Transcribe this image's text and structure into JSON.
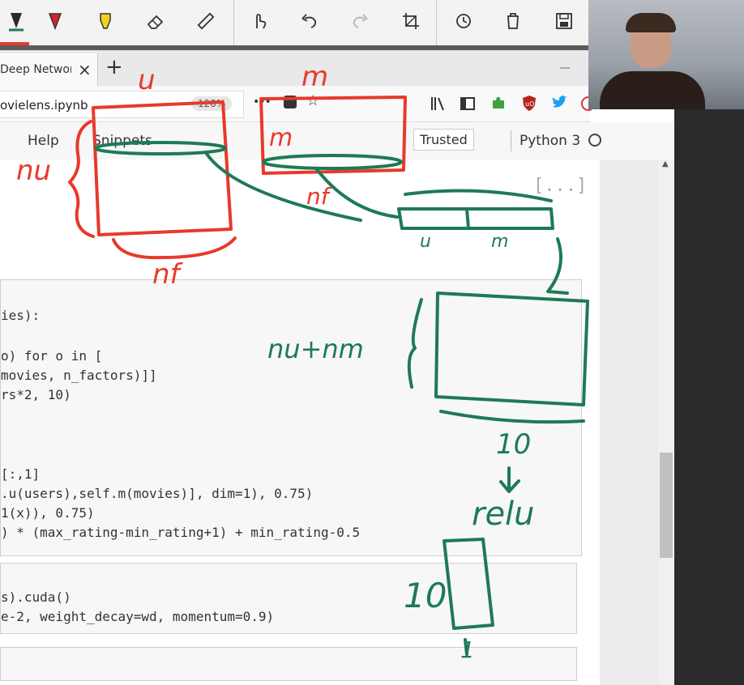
{
  "browser": {
    "tab_title": "Deep Network",
    "tab_close": "×",
    "new_tab": "+",
    "minimize": "—",
    "url_text": "ovielens.ipynb",
    "zoom": "120%",
    "more": "•••"
  },
  "jupyter": {
    "menu_help": "Help",
    "menu_snippets": "Snippets",
    "trusted": "Trusted",
    "kernel": "Python 3"
  },
  "notebook": {
    "collapsed_marker": "[...]",
    "cell1_lines": [
      "ies):",
      "o) for o in [",
      "movies, n_factors)]]",
      "rs*2, 10)",
      "[:,1]",
      ".u(users),self.m(movies)], dim=1), 0.75)",
      "1(x)), 0.75)",
      ") * (max_rating-min_rating+1) + min_rating-0.5"
    ],
    "cell2_lines": [
      "s).cuda()",
      "e-2, weight_decay=wd, momentum=0.9)"
    ]
  },
  "annotations": {
    "u_label": "u",
    "m_label": "m",
    "m_inner": "m",
    "nu_label": "nu",
    "nf_label_1": "nf",
    "nf_label_2": "nf",
    "concat_u": "u",
    "concat_m": "m",
    "num_label": "nu+nm",
    "ten_label": "10",
    "relu_label": "relu",
    "ten_out": "10",
    "one_out": "1"
  },
  "colors": {
    "ink_red": "#e8392b",
    "ink_green": "#1e7a55"
  }
}
